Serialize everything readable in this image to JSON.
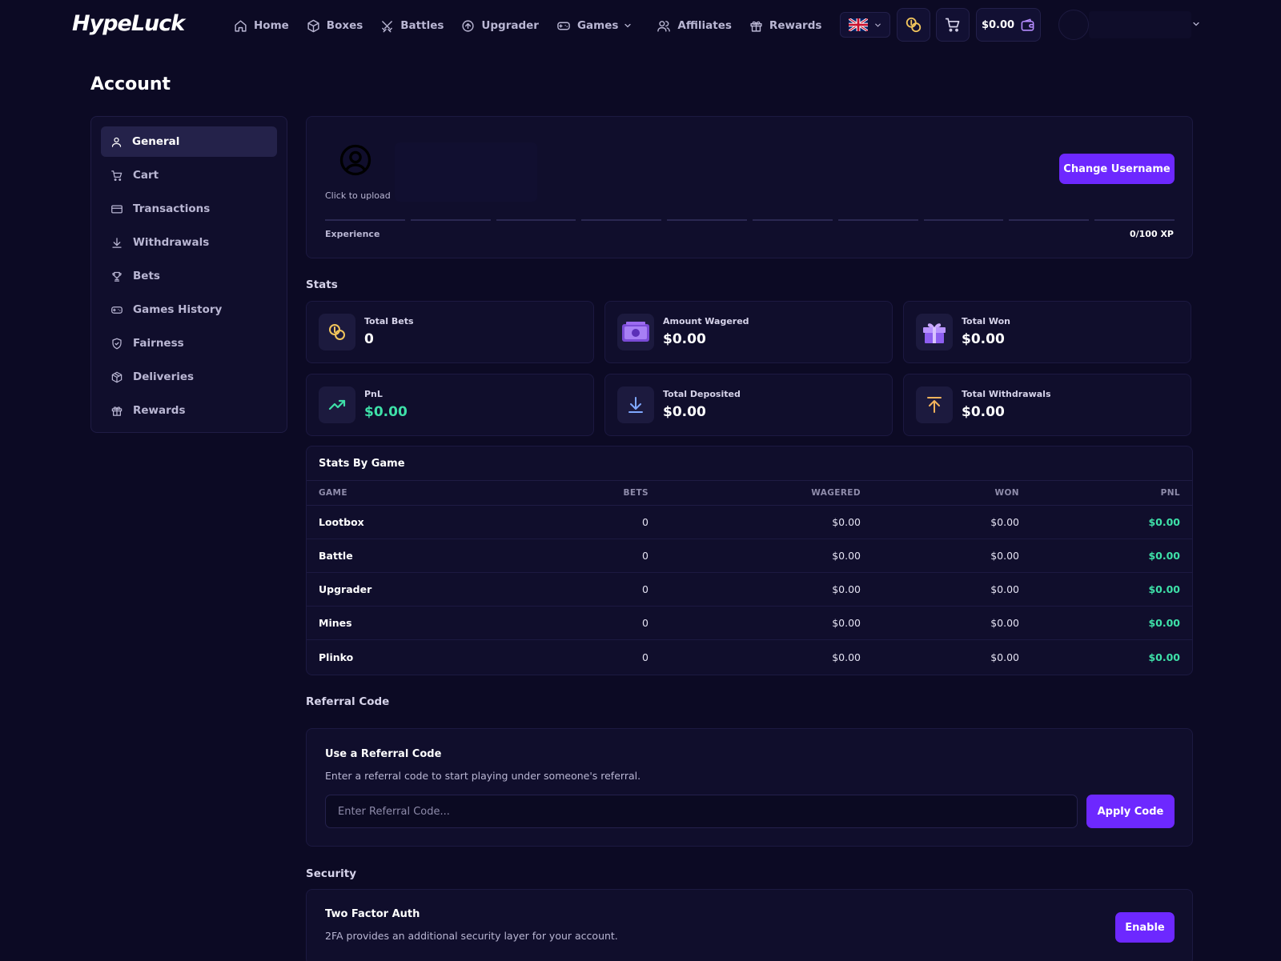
{
  "brand": {
    "logo": "HypeLuck"
  },
  "nav": {
    "items": [
      {
        "label": "Home",
        "icon": "home-icon"
      },
      {
        "label": "Boxes",
        "icon": "box-icon"
      },
      {
        "label": "Battles",
        "icon": "swords-icon"
      },
      {
        "label": "Upgrader",
        "icon": "upgrade-icon"
      },
      {
        "label": "Games",
        "icon": "gamepad-icon",
        "dropdown": true
      },
      {
        "label": "Affiliates",
        "icon": "users-icon"
      },
      {
        "label": "Rewards",
        "icon": "gift-icon"
      }
    ],
    "language_icon": "uk-flag-icon",
    "balance": "$0.00"
  },
  "page": {
    "title": "Account"
  },
  "sidebar": {
    "items": [
      {
        "label": "General",
        "icon": "user-icon",
        "active": true
      },
      {
        "label": "Cart",
        "icon": "cart-icon"
      },
      {
        "label": "Transactions",
        "icon": "card-icon"
      },
      {
        "label": "Withdrawals",
        "icon": "download-icon"
      },
      {
        "label": "Bets",
        "icon": "trophy-icon"
      },
      {
        "label": "Games History",
        "icon": "gamepad-icon"
      },
      {
        "label": "Fairness",
        "icon": "shield-icon"
      },
      {
        "label": "Deliveries",
        "icon": "package-icon"
      },
      {
        "label": "Rewards",
        "icon": "gift-icon"
      }
    ]
  },
  "profile": {
    "upload_text": "Click to upload",
    "change_username": "Change Username",
    "experience_label": "Experience",
    "xp_current": "0",
    "xp_total": "/100 XP",
    "xp_progress": 0
  },
  "stats": {
    "title": "Stats",
    "total_bets": {
      "label": "Total Bets",
      "value": "0"
    },
    "amount_wagered": {
      "label": "Amount Wagered",
      "value": "$0.00"
    },
    "total_won": {
      "label": "Total Won",
      "value": "$0.00"
    },
    "pnl": {
      "label": "PnL",
      "value": "$0.00"
    },
    "total_deposited": {
      "label": "Total Deposited",
      "value": "$0.00"
    },
    "total_withdrawals": {
      "label": "Total Withdrawals",
      "value": "$0.00"
    }
  },
  "stats_by_game": {
    "title": "Stats By Game",
    "columns": [
      "GAME",
      "BETS",
      "WAGERED",
      "WON",
      "PNL"
    ],
    "rows": [
      {
        "game": "Lootbox",
        "bets": "0",
        "wagered": "$0.00",
        "won": "$0.00",
        "pnl": "$0.00"
      },
      {
        "game": "Battle",
        "bets": "0",
        "wagered": "$0.00",
        "won": "$0.00",
        "pnl": "$0.00"
      },
      {
        "game": "Upgrader",
        "bets": "0",
        "wagered": "$0.00",
        "won": "$0.00",
        "pnl": "$0.00"
      },
      {
        "game": "Mines",
        "bets": "0",
        "wagered": "$0.00",
        "won": "$0.00",
        "pnl": "$0.00"
      },
      {
        "game": "Plinko",
        "bets": "0",
        "wagered": "$0.00",
        "won": "$0.00",
        "pnl": "$0.00"
      }
    ]
  },
  "referral": {
    "section_title": "Referral Code",
    "card_title": "Use a Referral Code",
    "description": "Enter a referral code to start playing under someone's referral.",
    "placeholder": "Enter Referral Code...",
    "value": "",
    "apply_label": "Apply Code"
  },
  "security": {
    "section_title": "Security",
    "card_title": "Two Factor Auth",
    "description": "2FA provides an additional security layer for your account.",
    "enable_label": "Enable"
  },
  "colors": {
    "background": "#0c0a24",
    "card": "#100e2c",
    "accent": "#6d28ff",
    "positive": "#3ee0a8",
    "muted_text": "#b9b6d3"
  }
}
